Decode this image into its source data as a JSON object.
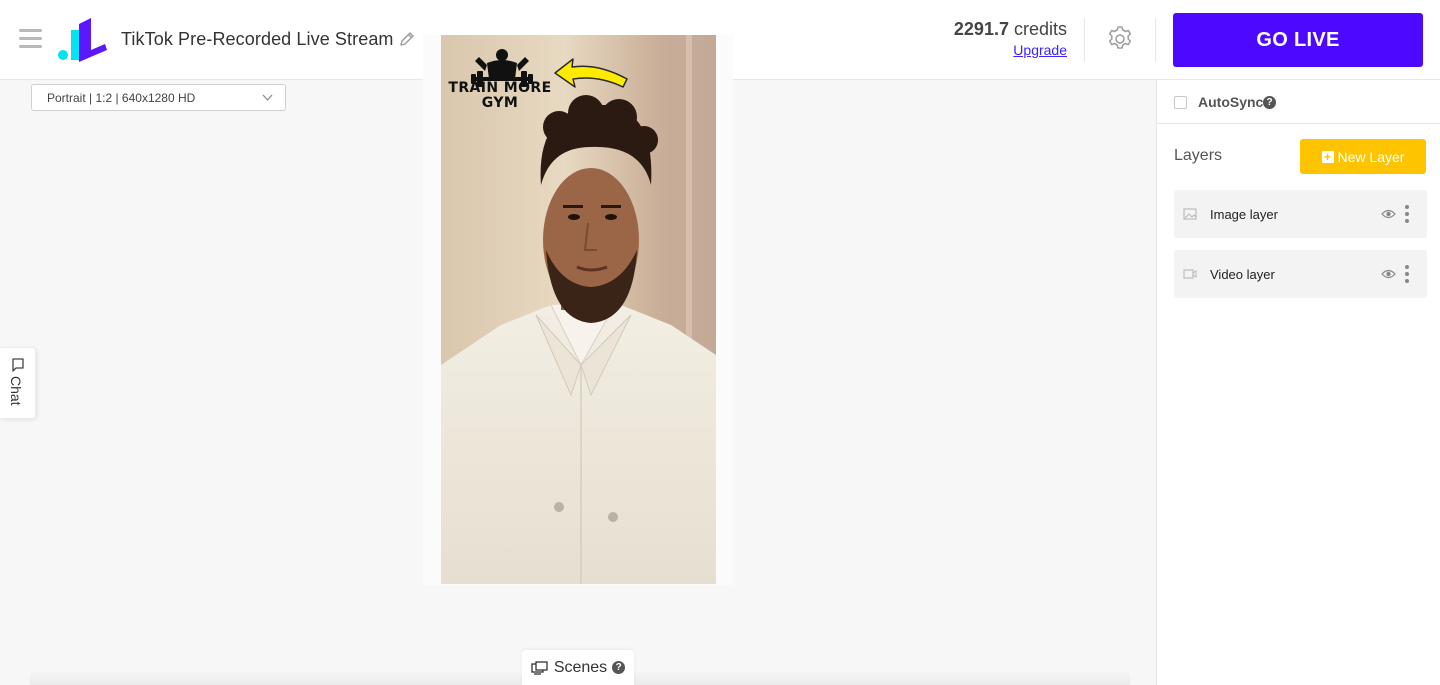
{
  "header": {
    "title": "TikTok Pre-Recorded Live Stream",
    "credits_amount": "2291.7",
    "credits_unit": "credits",
    "upgrade_label": "Upgrade",
    "go_live_label": "GO LIVE"
  },
  "canvas": {
    "format_selected": "Portrait | 1:2 | 640x1280 HD",
    "overlay_text_line1": "TRAIN MORE",
    "overlay_text_line2": "GYM"
  },
  "chat_tab": {
    "label": "Chat"
  },
  "scenes": {
    "label": "Scenes",
    "help": "?"
  },
  "right_panel": {
    "autosync_label": "AutoSync",
    "autosync_checked": false,
    "autosync_help": "?",
    "layers_title": "Layers",
    "new_layer_label": "New Layer",
    "layers": [
      {
        "name": "Image layer",
        "type_icon": "image-icon"
      },
      {
        "name": "Video layer",
        "type_icon": "video-icon"
      }
    ]
  },
  "colors": {
    "go_live": "#4d09ff",
    "new_layer": "#ffc400",
    "link": "#3b22ff",
    "logo_cyan": "#00e5f0",
    "logo_purple": "#5b18ff"
  }
}
